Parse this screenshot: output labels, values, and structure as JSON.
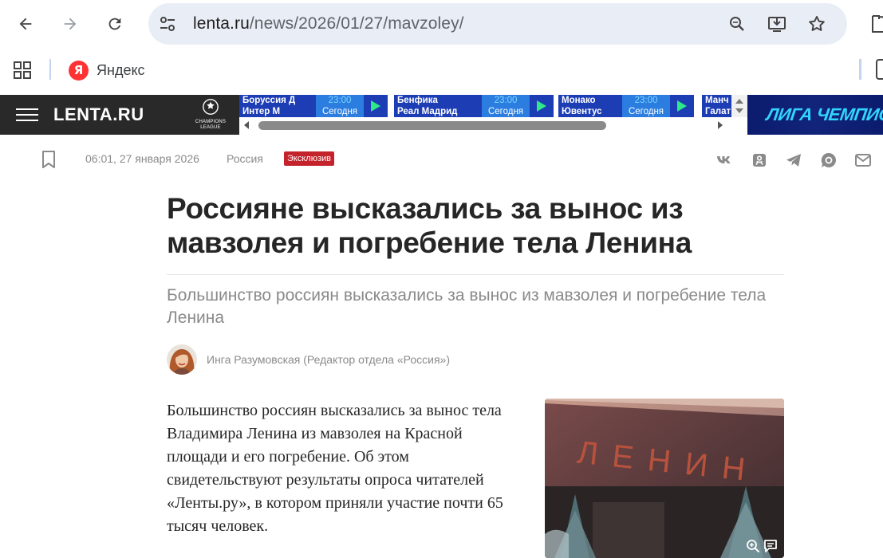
{
  "browser": {
    "url_host": "lenta.ru",
    "url_path": "/news/2026/01/27/mavzoley/",
    "bookmarks": [
      {
        "label": "Яндекс",
        "logo_letter": "Я"
      }
    ]
  },
  "site": {
    "logo": "LENTA.RU",
    "ucl_label_1": "CHAMPIONS",
    "ucl_label_2": "LEAGUE",
    "banner_text": "ЛИГА ЧЕМПИОНОВ"
  },
  "matches": [
    {
      "team1": "Боруссия Д",
      "team2": "Интер М",
      "time": "23:00",
      "day": "Сегодня"
    },
    {
      "team1": "Бенфика",
      "team2": "Реал Мадрид",
      "time": "23:00",
      "day": "Сегодня"
    },
    {
      "team1": "Монако",
      "team2": "Ювентус",
      "time": "23:00",
      "day": "Сегодня"
    },
    {
      "team1": "Манч",
      "team2": "Галат",
      "time": "",
      "day": ""
    }
  ],
  "article": {
    "date": "06:01, 27 января 2026",
    "rubric": "Россия",
    "badge": "Эксклюзив",
    "title": "Россияне высказались за вынос из мавзолея и погребение тела Ленина",
    "subtitle": "Большинство россиян высказались за вынос из мавзолея и погребение тела Ленина",
    "author": "Инга Разумовская (Редактор отдела «Россия»)",
    "lead": "Большинство россиян высказались за вынос тела Владимира Ленина из мавзолея на Красной площади и его погребение. Об этом свидетельствуют результаты опроса читателей «Ленты.ру», в котором приняли участие почти 65 тысяч человек.",
    "photo_text": "ЛЕНИН"
  },
  "share_icons": [
    "vk-icon",
    "ok-icon",
    "telegram-icon",
    "max-icon",
    "mail-icon"
  ],
  "colors": {
    "header_bg": "#292929",
    "score_blue": "#1d3db5",
    "time_blue": "#2b7de0",
    "badge_red": "#c4232b",
    "omnibox_bg": "#e9eef6"
  }
}
